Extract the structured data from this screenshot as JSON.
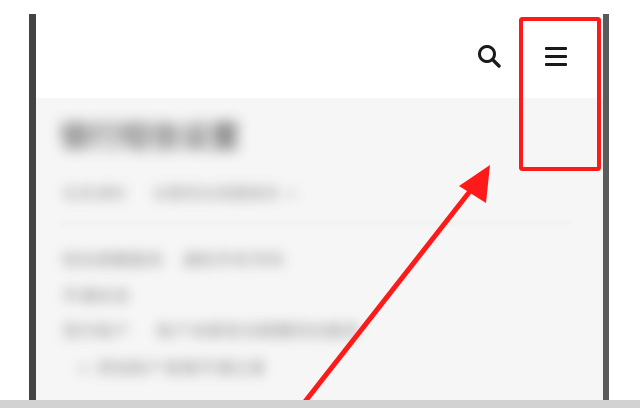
{
  "header": {
    "icons": {
      "search": "search-icon",
      "menu": "hamburger-menu-icon"
    }
  },
  "content": {
    "title": "银行短信设置",
    "meta": [
      "信息通知",
      "设置短信提醒服务 >"
    ],
    "rows": [
      [
        "短信提醒服务",
        "通知手机号码"
      ],
      [
        "开通状态"
      ],
      [
        "签约账户",
        "账户余额变动提醒短信服务"
      ],
      [
        "+ 添加账户",
        "查看开通记录"
      ]
    ]
  },
  "annotation": {
    "color": "#ff1a1a"
  }
}
